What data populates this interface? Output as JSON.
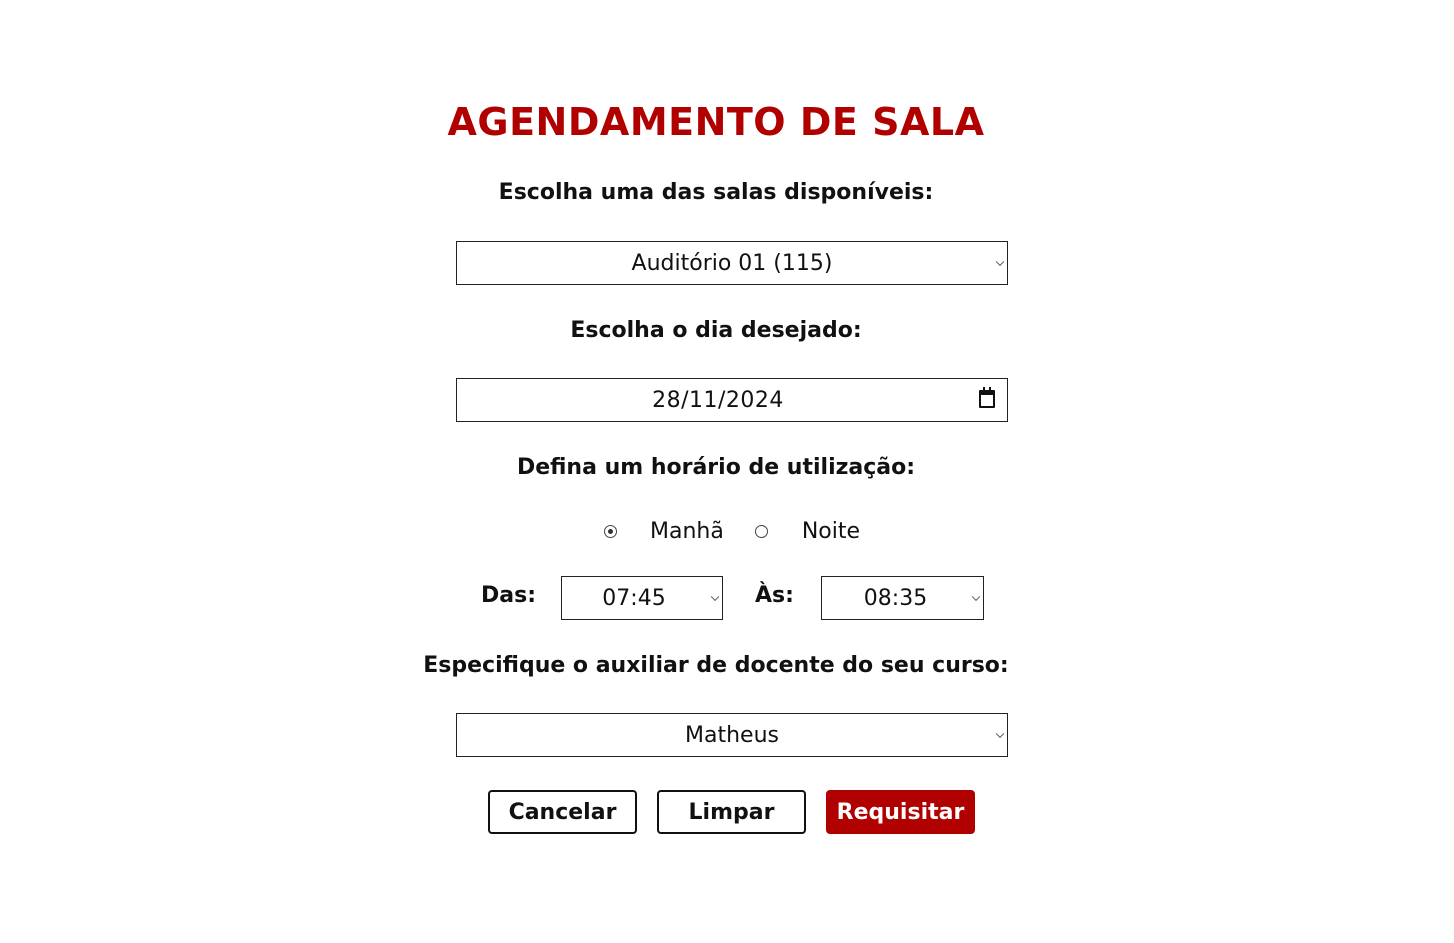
{
  "title": "AGENDAMENTO DE SALA",
  "room": {
    "label": "Escolha uma das salas disponíveis:",
    "selected": "Auditório 01 (115)"
  },
  "date": {
    "label": "Escolha o dia desejado:",
    "value": "28/11/2024"
  },
  "schedule": {
    "label": "Defina um horário de utilização:",
    "options": [
      "Manhã",
      "Noite"
    ],
    "selected": "Manhã",
    "from_label": "Das:",
    "from_value": "07:45",
    "to_label": "Às:",
    "to_value": "08:35"
  },
  "assistant": {
    "label": "Especifique o auxiliar de docente do seu curso:",
    "selected": "Matheus"
  },
  "buttons": {
    "cancel": "Cancelar",
    "clear": "Limpar",
    "submit": "Requisitar"
  },
  "colors": {
    "accent": "#b00000",
    "text": "#111111",
    "background": "#ffffff"
  }
}
